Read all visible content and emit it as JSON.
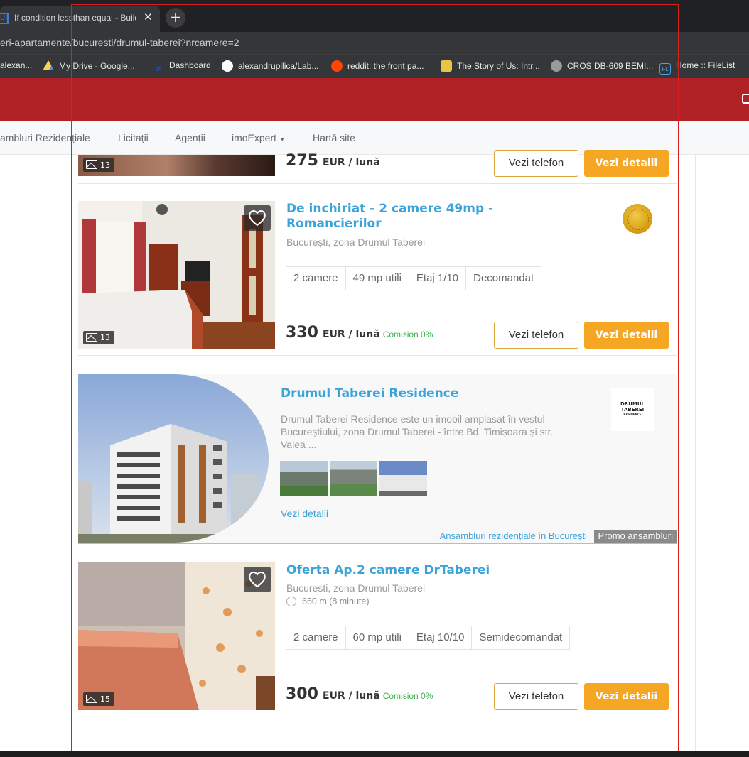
{
  "browser": {
    "tab_title": "If condition lessthan equal - Build",
    "tab_favicon": "UI",
    "url": "eri-apartamente/bucuresti/drumul-taberei?nrcamere=2",
    "bookmarks": [
      {
        "label": "alexan...",
        "icon": "bookmark-icon"
      },
      {
        "label": "My Drive - Google...",
        "icon": "google-drive-icon"
      },
      {
        "label": "Dashboard",
        "icon": "ui-icon"
      },
      {
        "label": "alexandrupilica/Lab...",
        "icon": "github-icon"
      },
      {
        "label": "reddit: the front pa...",
        "icon": "reddit-icon"
      },
      {
        "label": "The Story of Us: Intr...",
        "icon": "crown-icon"
      },
      {
        "label": "CROS DB-609 BEMI...",
        "icon": "globe-icon"
      },
      {
        "label": "Home :: FileList",
        "icon": "filelist-icon"
      }
    ]
  },
  "nav": {
    "items": [
      "ambluri Rezidențiale",
      "Licitații",
      "Agenții",
      "imoExpert",
      "Hartă site"
    ]
  },
  "listing_top": {
    "photo_count": "13",
    "price": "275",
    "price_unit": "EUR / lună",
    "phone_label": "Vezi telefon",
    "details_label": "Vezi detalii"
  },
  "listing_1": {
    "title": "De inchiriat - 2 camere 49mp - Romancierilor",
    "location": "București, zona Drumul Taberei",
    "features": [
      "2 camere",
      "49 mp utili",
      "Etaj 1/10",
      "Decomandat"
    ],
    "photo_count": "13",
    "price": "330",
    "price_unit": "EUR / lună",
    "commission": "Comision 0%",
    "phone_label": "Vezi telefon",
    "details_label": "Vezi detalii"
  },
  "promo": {
    "title": "Drumul Taberei Residence",
    "description": "Drumul Taberei Residence este un imobil amplasat în vestul Bucureștiului, zona Drumul Taberei - între Bd. Timișoara și str. Valea ...",
    "link": "Vezi detalii",
    "footer_link": "Ansambluri rezidențiale în București",
    "tag": "Promo ansambluri",
    "logo_line1": "DRUMUL TABEREI",
    "logo_line2": "RESIDENCE"
  },
  "listing_2": {
    "title": "Oferta Ap.2 camere DrTaberei",
    "location": "Bucuresti, zona Drumul Taberei",
    "metro": "660 m (8 minute)",
    "features": [
      "2 camere",
      "60 mp utili",
      "Etaj 10/10",
      "Semidecomandat"
    ],
    "photo_count": "15",
    "price": "300",
    "price_unit": "EUR / lună",
    "commission": "Comision 0%",
    "phone_label": "Vezi telefon",
    "details_label": "Vezi detalii"
  },
  "colors": {
    "brand_red": "#b12227",
    "link_blue": "#3aa3d9",
    "button_orange": "#f5a623",
    "commission_green": "#3ab14a"
  }
}
